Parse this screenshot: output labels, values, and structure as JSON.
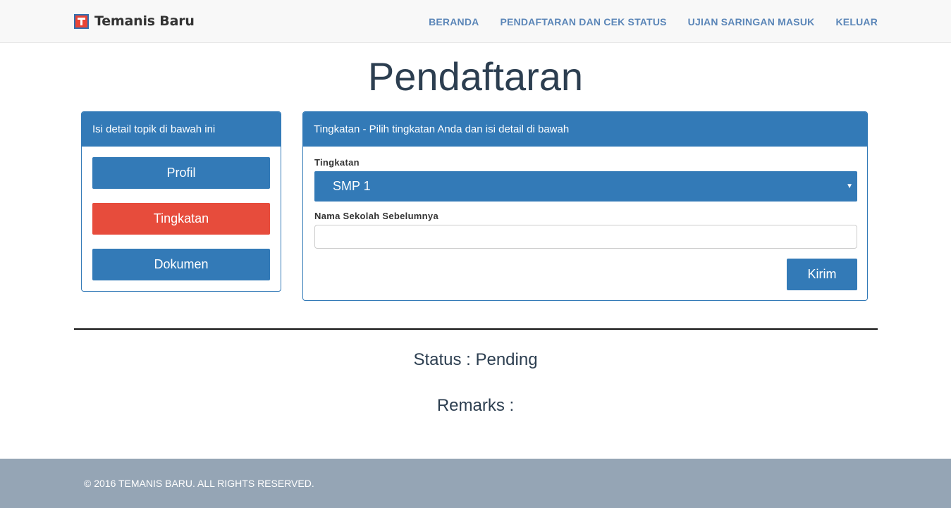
{
  "navbar": {
    "brand": "Temanis Baru",
    "logo_icon": "temanis-logo-icon",
    "links": [
      {
        "label": "BERANDA"
      },
      {
        "label": "PENDAFTARAN DAN CEK STATUS"
      },
      {
        "label": "UJIAN SARINGAN MASUK"
      },
      {
        "label": "KELUAR"
      }
    ]
  },
  "page": {
    "title": "Pendaftaran"
  },
  "left_panel": {
    "heading": "Isi detail topik di bawah ini",
    "buttons": [
      {
        "label": "Profil",
        "active": false
      },
      {
        "label": "Tingkatan",
        "active": true
      },
      {
        "label": "Dokumen",
        "active": false
      }
    ]
  },
  "right_panel": {
    "heading": "Tingkatan - Pilih tingkatan Anda dan isi detail di bawah",
    "level_label": "Tingkatan",
    "level_value": "SMP 1",
    "caret_icon": "caret-down-icon",
    "school_label": "Nama Sekolah Sebelumnya",
    "school_value": "",
    "submit_label": "Kirim"
  },
  "status": {
    "status_text": "Status : Pending",
    "remarks_text": "Remarks :"
  },
  "footer": {
    "copyright": "© 2016 TEMANIS BARU. ALL RIGHTS RESERVED."
  },
  "colors": {
    "primary": "#337ab7",
    "active": "#e74c3c",
    "footer_bg": "#95a5b5",
    "nav_link": "#5b86b8"
  }
}
